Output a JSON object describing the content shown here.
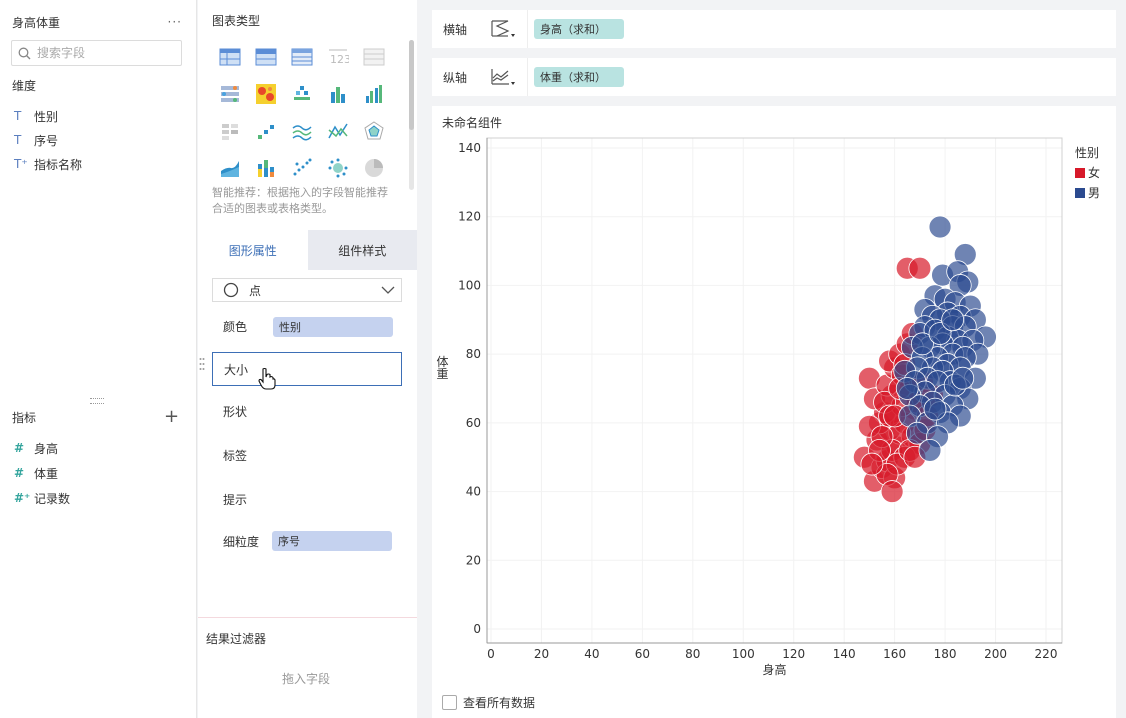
{
  "dataset": {
    "title": "身高体重",
    "more_label": "···",
    "search_placeholder": "搜索字段",
    "dimensions_label": "维度",
    "dimensions": [
      {
        "type_icon": "T",
        "name": "性别"
      },
      {
        "type_icon": "T",
        "name": "序号"
      },
      {
        "type_icon": "T⁺",
        "name": "指标名称"
      }
    ],
    "measures_label": "指标",
    "add_label": "+",
    "measures": [
      {
        "type_icon": "#",
        "name": "身高"
      },
      {
        "type_icon": "#",
        "name": "体重"
      },
      {
        "type_icon": "#⁺",
        "name": "记录数"
      }
    ]
  },
  "chart_types": {
    "title": "图表类型",
    "hint": "智能推荐：根据拖入的字段智能推荐合适的图表或表格类型。"
  },
  "properties": {
    "tabs": [
      "图形属性",
      "组件样式"
    ],
    "mark_type": "点",
    "color_label": "颜色",
    "color_field": "性别",
    "size_label": "大小",
    "shape_label": "形状",
    "label_label": "标签",
    "tooltip_label": "提示",
    "granularity_label": "细粒度",
    "granularity_field": "序号"
  },
  "filter": {
    "title": "结果过滤器",
    "placeholder": "拖入字段"
  },
  "x_axis": {
    "label": "横轴",
    "field": "身高（求和）"
  },
  "y_axis": {
    "label": "纵轴",
    "field": "体重（求和）"
  },
  "component": {
    "title": "未命名组件",
    "view_all_label": "查看所有数据"
  },
  "colors": {
    "female": "#d7192a",
    "male": "#2b4a8f",
    "accent": "#3d6fb6"
  },
  "chart_data": {
    "type": "scatter",
    "title": "未命名组件",
    "xlabel": "身高",
    "ylabel": "体重",
    "xlim": [
      0,
      220
    ],
    "ylim": [
      0,
      140
    ],
    "xticks": [
      0,
      20,
      40,
      60,
      80,
      100,
      120,
      140,
      160,
      180,
      200,
      220
    ],
    "yticks": [
      0,
      20,
      40,
      60,
      80,
      100,
      120,
      140
    ],
    "legend_title": "性别",
    "legend_position": "right",
    "series": [
      {
        "name": "女",
        "color": "#d7192a",
        "points": [
          [
            165,
            105
          ],
          [
            170,
            105
          ],
          [
            150,
            73
          ],
          [
            148,
            50
          ],
          [
            152,
            43
          ],
          [
            155,
            47
          ],
          [
            153,
            55
          ],
          [
            157,
            49
          ],
          [
            160,
            44
          ],
          [
            161,
            53
          ],
          [
            158,
            58
          ],
          [
            154,
            60
          ],
          [
            156,
            63
          ],
          [
            152,
            67
          ],
          [
            159,
            68
          ],
          [
            157,
            71
          ],
          [
            160,
            76
          ],
          [
            158,
            78
          ],
          [
            162,
            80
          ],
          [
            165,
            83
          ],
          [
            167,
            86
          ],
          [
            163,
            74
          ],
          [
            166,
            70
          ],
          [
            168,
            64
          ],
          [
            164,
            60
          ],
          [
            167,
            56
          ],
          [
            170,
            54
          ],
          [
            172,
            58
          ],
          [
            169,
            66
          ],
          [
            171,
            72
          ],
          [
            162,
            57
          ],
          [
            159,
            52
          ],
          [
            164,
            50
          ],
          [
            150,
            59
          ],
          [
            155,
            56
          ],
          [
            161,
            48
          ],
          [
            163,
            65
          ],
          [
            156,
            66
          ],
          [
            158,
            62
          ],
          [
            166,
            52
          ],
          [
            168,
            50
          ],
          [
            173,
            62
          ],
          [
            175,
            68
          ],
          [
            160,
            62
          ],
          [
            162,
            70
          ],
          [
            154,
            52
          ],
          [
            157,
            45
          ],
          [
            159,
            40
          ],
          [
            151,
            48
          ],
          [
            164,
            77
          ]
        ]
      },
      {
        "name": "男",
        "color": "#2b4a8f",
        "points": [
          [
            178,
            117
          ],
          [
            188,
            109
          ],
          [
            179,
            103
          ],
          [
            185,
            104
          ],
          [
            189,
            101
          ],
          [
            186,
            100
          ],
          [
            176,
            97
          ],
          [
            180,
            96
          ],
          [
            184,
            95
          ],
          [
            172,
            93
          ],
          [
            190,
            94
          ],
          [
            181,
            92
          ],
          [
            175,
            91
          ],
          [
            186,
            91
          ],
          [
            192,
            90
          ],
          [
            178,
            90
          ],
          [
            183,
            88
          ],
          [
            188,
            88
          ],
          [
            172,
            88
          ],
          [
            196,
            85
          ],
          [
            170,
            86
          ],
          [
            176,
            87
          ],
          [
            181,
            85
          ],
          [
            185,
            84
          ],
          [
            191,
            84
          ],
          [
            179,
            83
          ],
          [
            187,
            82
          ],
          [
            174,
            82
          ],
          [
            167,
            82
          ],
          [
            193,
            80
          ],
          [
            183,
            80
          ],
          [
            177,
            79
          ],
          [
            171,
            79
          ],
          [
            188,
            79
          ],
          [
            181,
            77
          ],
          [
            175,
            76
          ],
          [
            169,
            76
          ],
          [
            186,
            76
          ],
          [
            179,
            75
          ],
          [
            164,
            75
          ],
          [
            173,
            73
          ],
          [
            192,
            73
          ],
          [
            182,
            72
          ],
          [
            177,
            72
          ],
          [
            168,
            72
          ],
          [
            186,
            70
          ],
          [
            172,
            69
          ],
          [
            180,
            68
          ],
          [
            166,
            68
          ],
          [
            189,
            67
          ],
          [
            175,
            66
          ],
          [
            183,
            65
          ],
          [
            170,
            65
          ],
          [
            178,
            63
          ],
          [
            186,
            62
          ],
          [
            166,
            62
          ],
          [
            173,
            60
          ],
          [
            181,
            60
          ],
          [
            169,
            57
          ],
          [
            177,
            56
          ],
          [
            174,
            52
          ],
          [
            184,
            71
          ],
          [
            171,
            83
          ],
          [
            178,
            86
          ],
          [
            183,
            90
          ],
          [
            165,
            70
          ],
          [
            176,
            64
          ],
          [
            187,
            73
          ]
        ]
      }
    ]
  }
}
